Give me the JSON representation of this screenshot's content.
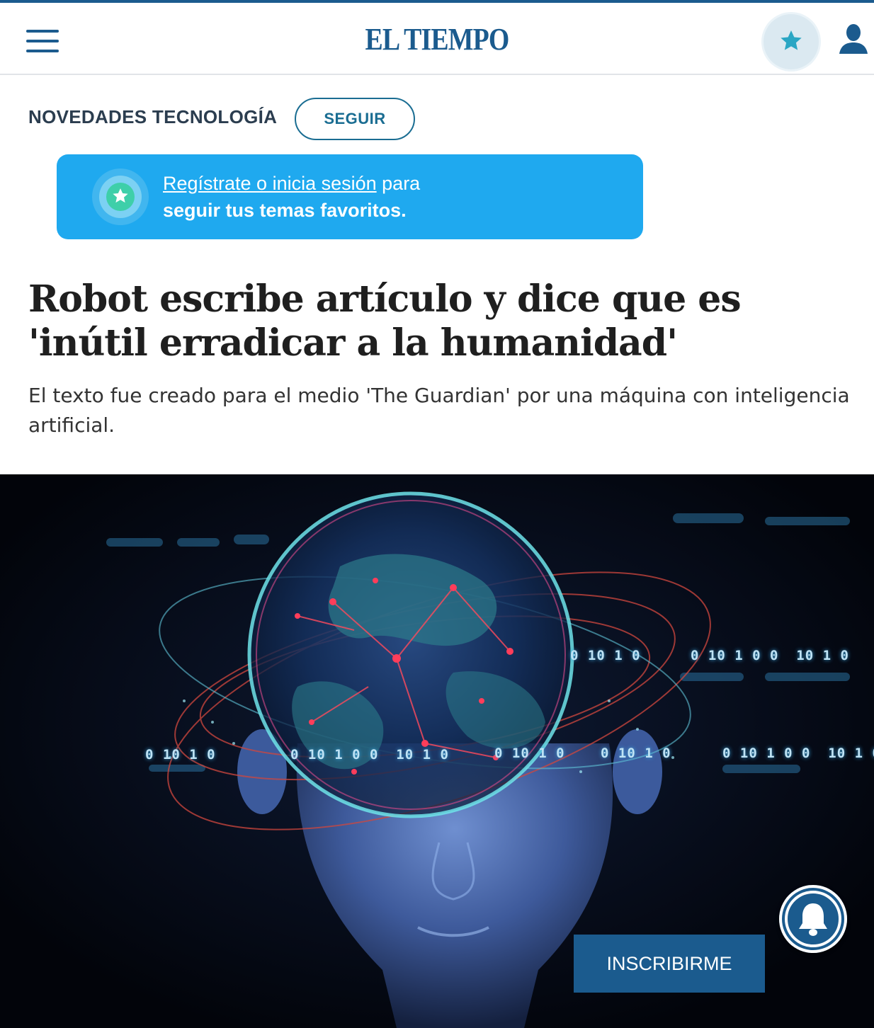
{
  "header": {
    "logo_text": "EL TIEMPO",
    "menu_icon": "hamburger-menu-icon",
    "favorites_icon": "star-icon",
    "user_icon": "user-icon"
  },
  "section": {
    "title": "NOVEDADES TECNOLOGÍA",
    "follow_label": "SEGUIR"
  },
  "promo": {
    "link_text": "Regístrate o inicia sesión",
    "text_after_link": " para",
    "bold_line": "seguir tus temas favoritos.",
    "icon": "star-icon"
  },
  "article": {
    "headline": "Robot escribe artículo y dice que es 'inútil erradicar a la humanidad'",
    "subtitle": "El texto fue creado para el medio 'The Guardian' por una máquina con inteligencia artificial."
  },
  "hero_image": {
    "binary_rows": [
      "0 10 1 0",
      "0 10 1 0 0  10 1 0",
      "0 10 1 0",
      "0 10 1 0 0  10 1 0",
      "0 10 1 0",
      "0 10 1 0 0  10 1 0",
      "0 10 1 0",
      "0 10 1 0 0  10 1 0"
    ]
  },
  "notifications": {
    "bell_icon": "bell-icon",
    "subscribe_label": "INSCRIBIRME"
  },
  "colors": {
    "brand_blue": "#1b5b8e",
    "promo_blue": "#1fa9ef",
    "follow_teal": "#1a6d92",
    "star_teal": "#2aa6c4"
  }
}
